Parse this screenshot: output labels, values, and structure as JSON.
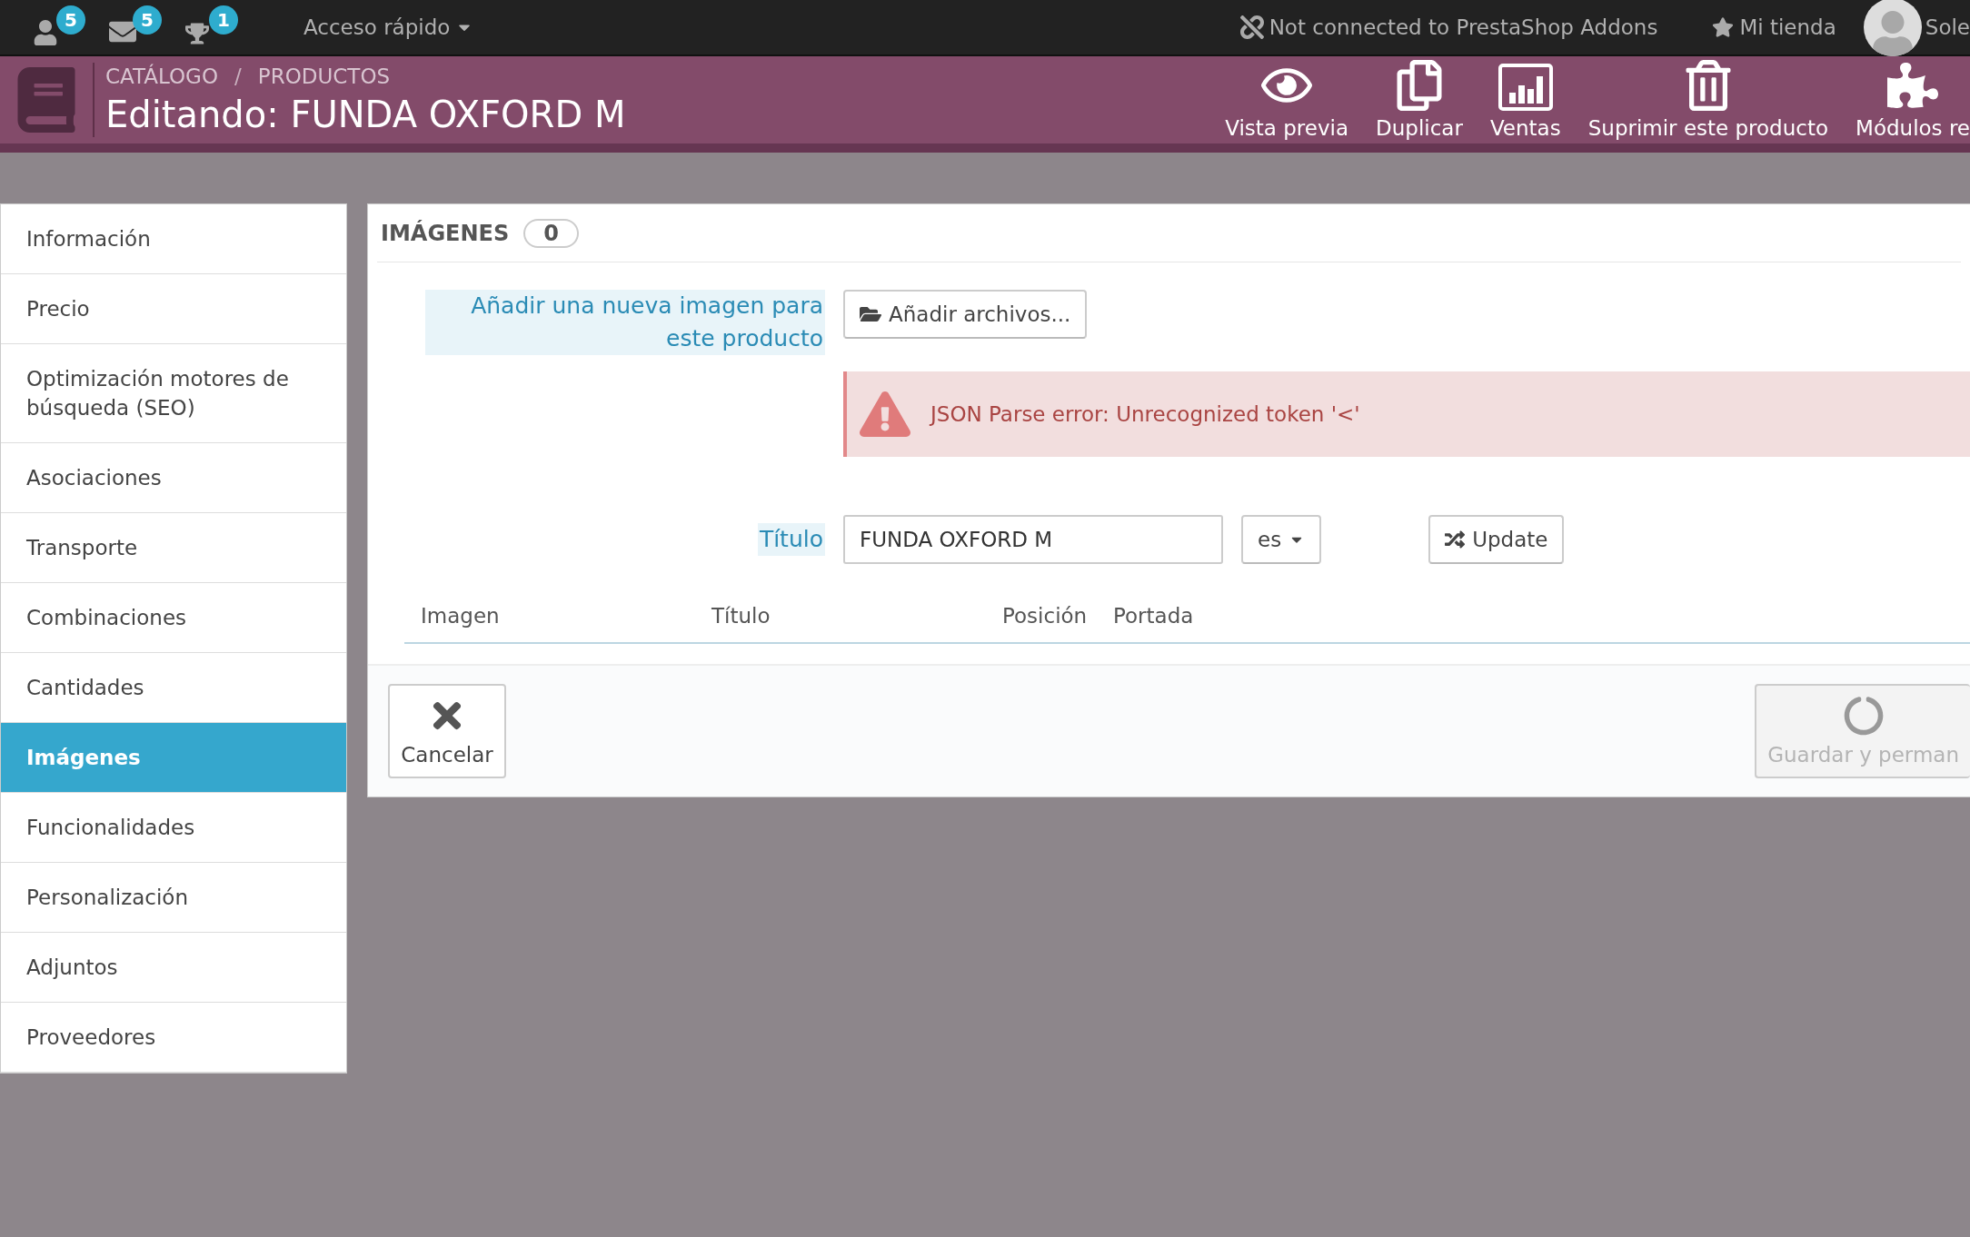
{
  "top_bar": {
    "notifications": [
      {
        "kind": "orders",
        "count": "5"
      },
      {
        "kind": "messages",
        "count": "5"
      },
      {
        "kind": "trophy",
        "count": "1"
      }
    ],
    "quick_access": "Acceso rápido",
    "addons_status": "Not connected to PrestaShop Addons",
    "shop_link": "Mi tienda",
    "user_name": "Sole"
  },
  "header": {
    "breadcrumb": [
      "CATÁLOGO",
      "PRODUCTOS"
    ],
    "breadcrumb_separator": "/",
    "title": "Editando: FUNDA OXFORD M",
    "toolbar": [
      {
        "kind": "preview",
        "label": "Vista previa"
      },
      {
        "kind": "duplicate",
        "label": "Duplicar"
      },
      {
        "kind": "sales",
        "label": "Ventas"
      },
      {
        "kind": "delete",
        "label": "Suprimir este producto"
      },
      {
        "kind": "modules",
        "label": "Módulos re"
      }
    ]
  },
  "sidebar": {
    "items": [
      {
        "label": "Información",
        "selected": false
      },
      {
        "label": "Precio",
        "selected": false
      },
      {
        "label": "Optimización motores de búsqueda (SEO)",
        "selected": false
      },
      {
        "label": "Asociaciones",
        "selected": false
      },
      {
        "label": "Transporte",
        "selected": false
      },
      {
        "label": "Combinaciones",
        "selected": false
      },
      {
        "label": "Cantidades",
        "selected": false
      },
      {
        "label": "Imágenes",
        "selected": true
      },
      {
        "label": "Funcionalidades",
        "selected": false
      },
      {
        "label": "Personalización",
        "selected": false
      },
      {
        "label": "Adjuntos",
        "selected": false
      },
      {
        "label": "Proveedores",
        "selected": false
      }
    ]
  },
  "panel": {
    "title": "IMÁGENES",
    "count": "0",
    "add_image": {
      "label": "Añadir una nueva imagen para este producto",
      "button": "Añadir archivos..."
    },
    "alert": "JSON Parse error: Unrecognized token '<'",
    "title_field": {
      "label": "Título",
      "value": "FUNDA OXFORD M",
      "language": "es",
      "button": "Update"
    },
    "table": {
      "columns": [
        "Imagen",
        "Título",
        "Posición",
        "Portada"
      ]
    },
    "footer": {
      "cancel": "Cancelar",
      "save": {
        "label": "Guardar y perman",
        "disabled": true
      }
    }
  }
}
